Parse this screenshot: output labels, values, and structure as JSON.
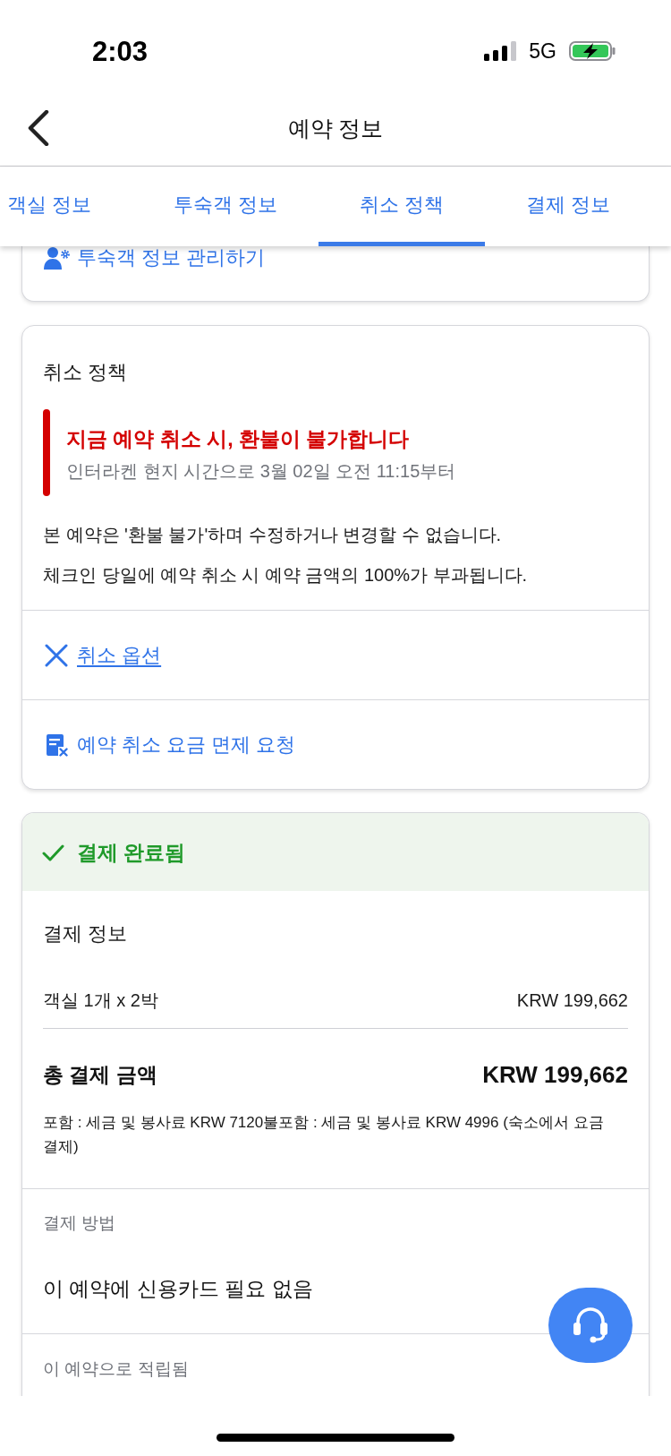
{
  "status_bar": {
    "time": "2:03",
    "network": "5G"
  },
  "header": {
    "title": "예약 정보"
  },
  "tabs": [
    {
      "label": "객실 정보",
      "selected": false
    },
    {
      "label": "투숙객 정보",
      "selected": false
    },
    {
      "label": "취소 정책",
      "selected": true
    },
    {
      "label": "결제 정보",
      "selected": false
    }
  ],
  "guest_card": {
    "link": "투숙객 정보 관리하기"
  },
  "cancellation_policy": {
    "title": "취소 정책",
    "alert": {
      "heading": "지금 예약 취소 시, 환불이 불가합니다",
      "subtext": "인터라켄 현지 시간으로 3월 02일 오전 11:15부터"
    },
    "notes": [
      "본 예약은 '환불 불가'하며 수정하거나 변경할 수 없습니다.",
      "체크인 당일에 예약 취소 시 예약 금액의 100%가 부과됩니다."
    ],
    "actions": [
      {
        "kind": "options",
        "label": "취소 옵션"
      },
      {
        "kind": "waiver",
        "label": "예약 취소 요금 면제 요청"
      }
    ]
  },
  "payment": {
    "status": "결제 완료됨",
    "title": "결제 정보",
    "line_items": [
      {
        "label": "객실 1개 x 2박",
        "amount": "KRW 199,662"
      }
    ],
    "total": {
      "label": "총 결제 금액",
      "amount": "KRW 199,662"
    },
    "tax_note": "포함 : 세금 및 봉사료 KRW 7120불포함 : 세금 및 봉사료 KRW 4996 (숙소에서 요금 결제)",
    "method_label": "결제 방법",
    "method_value": "이 예약에 신용카드 필요 없음",
    "rewards_label": "이 예약으로 적립됨"
  }
}
